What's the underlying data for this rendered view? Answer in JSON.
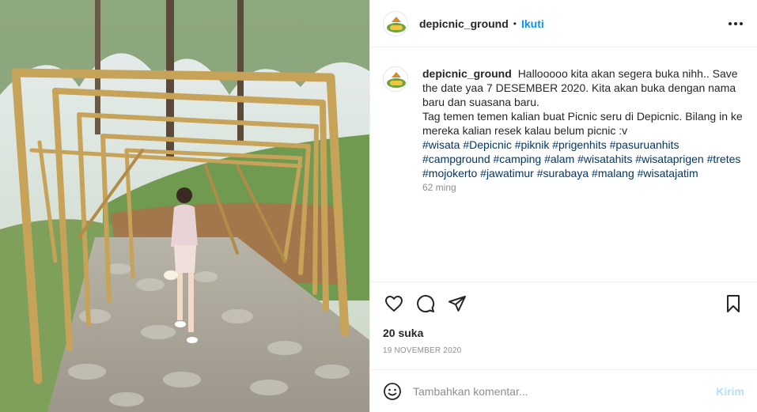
{
  "post": {
    "username": "depicnic_ground",
    "separator": "•",
    "follow_label": "Ikuti",
    "more_icon": "more-options-icon",
    "photo_alt": "photo"
  },
  "caption": {
    "username": "depicnic_ground",
    "line1": "Hallooooo kita akan segera buka nihh.. Save the date yaa 7 DESEMBER 2020. Kita akan buka dengan nama baru dan suasana baru.",
    "line2": "Tag temen temen kalian buat Picnic seru di Depicnic. Bilang in ke mereka kalian resek kalau belum picnic :v",
    "hashtags": [
      "#wisata",
      "#Depicnic",
      "#piknik",
      "#prigenhits",
      "#pasuruanhits",
      "#campground",
      "#camping",
      "#alam",
      "#wisatahits",
      "#wisataprigen",
      "#tretes",
      "#mojokerto",
      "#jawatimur",
      "#surabaya",
      "#malang",
      "#wisatajatim"
    ],
    "age": "62 ming"
  },
  "actions": {
    "like_icon": "heart-icon",
    "comment_icon": "comment-icon",
    "share_icon": "share-icon",
    "save_icon": "bookmark-icon"
  },
  "stats": {
    "likes": "20 suka",
    "date": "19 NOVEMBER 2020"
  },
  "comment": {
    "emoji_icon": "emoji-icon",
    "placeholder": "Tambahkan komentar...",
    "post_label": "Kirim"
  },
  "colors": {
    "link": "#0095f6",
    "hashtag": "#00376b",
    "muted": "#8e8e8e",
    "post_disabled": "#b2dffc"
  }
}
